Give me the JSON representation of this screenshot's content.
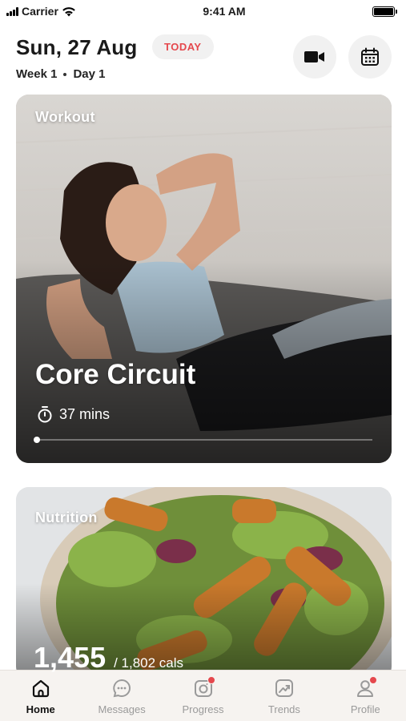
{
  "status_bar": {
    "carrier": "Carrier",
    "time": "9:41 AM"
  },
  "header": {
    "date": "Sun, 27 Aug",
    "today_badge": "TODAY",
    "week": "Week 1",
    "day": "Day 1"
  },
  "header_actions": [
    {
      "icon": "video-camera-icon"
    },
    {
      "icon": "calendar-icon"
    }
  ],
  "workout_card": {
    "label": "Workout",
    "title": "Core Circuit",
    "duration": "37 mins",
    "progress_fraction": 0.0
  },
  "nutrition_card": {
    "label": "Nutrition",
    "calories_consumed": "1,455",
    "calories_goal": "/ 1,802 cals"
  },
  "tabs": [
    {
      "label": "Home",
      "icon": "home-icon",
      "active": true,
      "badge": false
    },
    {
      "label": "Messages",
      "icon": "chat-icon",
      "active": false,
      "badge": false
    },
    {
      "label": "Progress",
      "icon": "camera-icon",
      "active": false,
      "badge": true
    },
    {
      "label": "Trends",
      "icon": "trend-chart-icon",
      "active": false,
      "badge": false
    },
    {
      "label": "Profile",
      "icon": "profile-icon",
      "active": false,
      "badge": true
    }
  ],
  "colors": {
    "accent_red": "#e5484d",
    "tab_active": "#111111",
    "tab_inactive": "#9a9a9a"
  }
}
